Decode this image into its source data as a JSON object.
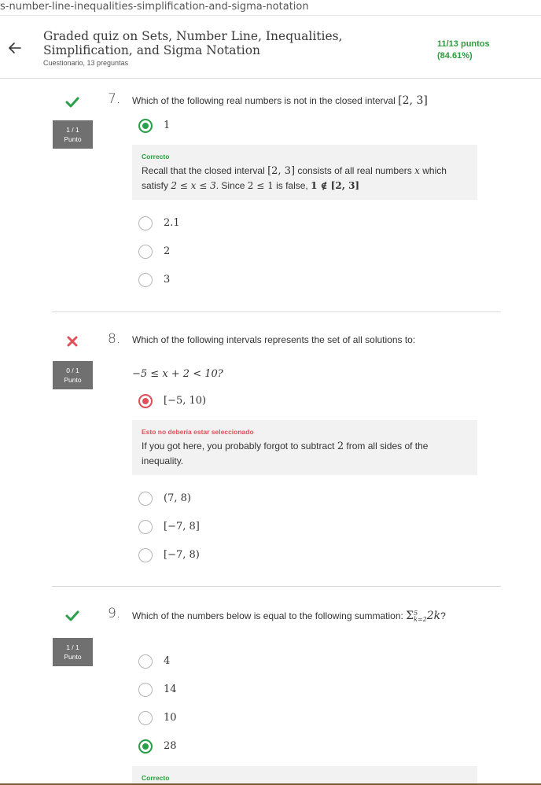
{
  "browser": {
    "url_fragment": "s-number-line-inequalities-simplification-and-sigma-notation"
  },
  "header": {
    "back_icon": "arrow-left-icon",
    "title": "Graded quiz on Sets, Number Line, Inequalities, Simplification, and Sigma Notation",
    "subtitle": "Cuestionario, 13 preguntas",
    "score_line1": "11/13 puntos",
    "score_line2": "(84.61%)",
    "score_color": "#2a9d3c"
  },
  "questions": [
    {
      "number": "7.",
      "status": "correct",
      "points": "1 / 1",
      "points_label": "Punto",
      "text_prefix": "Which of the following real numbers is not in the closed interval ",
      "text_math": "[2, 3]",
      "options": [
        {
          "label": "1",
          "selected": true
        },
        {
          "label": "2.1",
          "selected": false
        },
        {
          "label": "2",
          "selected": false
        },
        {
          "label": "3",
          "selected": false
        }
      ],
      "feedback": {
        "title": "Correcto",
        "line1_a": "Recall that the closed interval ",
        "line1_math": "[2, 3]",
        "line1_b": " consists of all real numbers ",
        "line1_var": "x",
        "line1_c": " which",
        "line2_a": "satisfy ",
        "line2_math": "2 ≤ x ≤ 3",
        "line2_b": ". Since ",
        "line2_math2": "2 ≤ 1",
        "line2_c": " is false, ",
        "line2_math3": "1 ∉ [2, 3]"
      }
    },
    {
      "number": "8.",
      "status": "incorrect",
      "points": "0 / 1",
      "points_label": "Punto",
      "text": "Which of the following intervals represents the set of all solutions to:",
      "inequality": "−5 ≤ x + 2 < 10?",
      "options": [
        {
          "label": "[−5, 10)",
          "selected": true
        },
        {
          "label": "(7, 8)",
          "selected": false
        },
        {
          "label": "[−7, 8]",
          "selected": false
        },
        {
          "label": "[−7, 8)",
          "selected": false
        }
      ],
      "feedback": {
        "title": "Esto no debería estar seleccionado",
        "text_a": "If you got here, you probably forgot to subtract ",
        "text_math": "2",
        "text_b": " from all sides of the",
        "text_c": "inequality."
      }
    },
    {
      "number": "9.",
      "status": "correct",
      "points": "1 / 1",
      "points_label": "Punto",
      "text_prefix": "Which of the numbers below is equal to the following summation: ",
      "text_math": "Σ",
      "text_sup": "5",
      "text_sub": "k=2",
      "text_math2": "2k",
      "text_suffix": "?",
      "options": [
        {
          "label": "4",
          "selected": false
        },
        {
          "label": "14",
          "selected": false
        },
        {
          "label": "10",
          "selected": false
        },
        {
          "label": "28",
          "selected": true
        }
      ],
      "feedback": {
        "title": "Correcto"
      }
    }
  ],
  "colors": {
    "correct": "#2aa04a",
    "incorrect": "#e0505a",
    "badge": "#707070"
  }
}
